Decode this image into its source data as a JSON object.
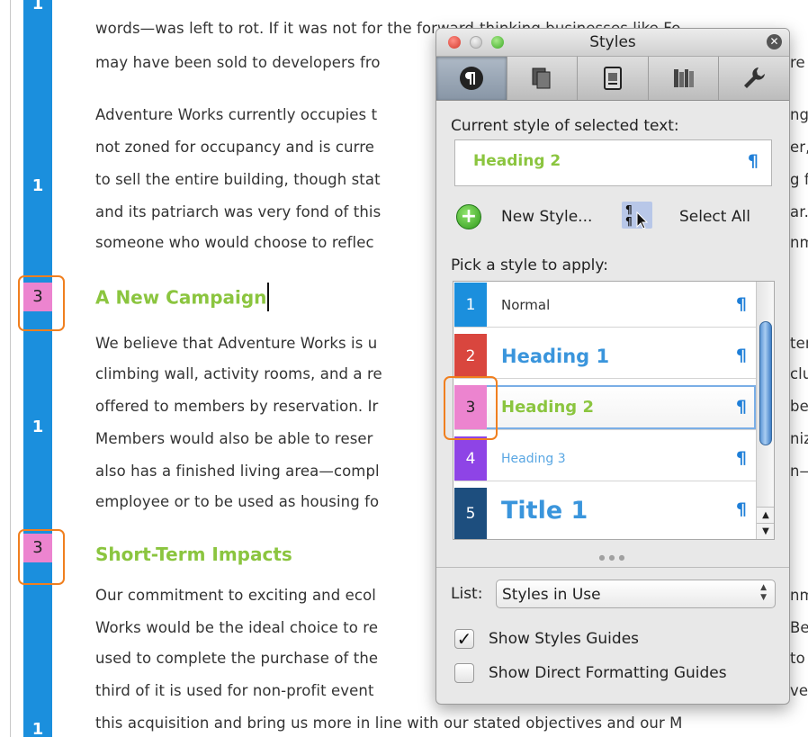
{
  "document": {
    "lines_block1": [
      "words—was left to rot. If it was not for the forward-thinking businesses like Fo",
      "may have been sold to developers fro"
    ],
    "lines_block1_right": [
      "re"
    ],
    "lines_block2": [
      "Adventure Works currently occupies t",
      "not zoned for occupancy and is curre",
      "to sell the entire building, though stat",
      "and its patriarch was very fond of this",
      "someone who would choose to reflec"
    ],
    "lines_block2_right": [
      "ng",
      "er,",
      "g fa",
      "ar.",
      "nm"
    ],
    "heading_campaign": "A New Campaign",
    "lines_block3": [
      "We believe that Adventure Works is u",
      "climbing wall, activity rooms, and a re",
      "offered to members by reservation. Ir",
      "Members would also be able to reser",
      "also has a finished living area—compl",
      "employee or to be used as housing fo"
    ],
    "lines_block3_right": [
      "ter",
      "clu",
      "be",
      "niz",
      "n—",
      ""
    ],
    "heading_impacts": "Short-Term Impacts",
    "lines_block4": [
      "Our commitment to exciting and ecol",
      "Works would be the ideal choice to re",
      "used to complete the purchase of the",
      "third of it is used for non-profit event",
      "this acquisition and bring us more in line with our stated objectives and our M"
    ],
    "lines_block4_right": [
      "nm",
      "Be",
      "to",
      "ver",
      ""
    ],
    "guides": {
      "normal_num": "1",
      "heading2_num": "3"
    }
  },
  "panel": {
    "title": "Styles",
    "close_glyph": "✕",
    "current_label": "Current style of selected text:",
    "current_style": "Heading 2",
    "pilcrow": "¶",
    "new_style": "New Style...",
    "select_all": "Select All",
    "pick_label": "Pick a style to apply:",
    "styles": [
      {
        "num": "1",
        "name": "Normal",
        "color": "#1b8fdd"
      },
      {
        "num": "2",
        "name": "Heading 1",
        "color": "#d9463e"
      },
      {
        "num": "3",
        "name": "Heading 2",
        "color": "#ec84cf"
      },
      {
        "num": "4",
        "name": "Heading 3",
        "color": "#8e44e6"
      },
      {
        "num": "5",
        "name": "Title 1",
        "color": "#1d4e7e"
      }
    ],
    "list_label": "List:",
    "list_value": "Styles in Use",
    "show_styles_guides": "Show Styles Guides",
    "show_direct_guides": "Show Direct Formatting Guides",
    "show_styles_guides_checked": true,
    "show_direct_guides_checked": false
  },
  "colors": {
    "guide_blue": "#1b8fdd",
    "heading2_green": "#8bc53f",
    "callout_orange": "#f07f1f"
  }
}
